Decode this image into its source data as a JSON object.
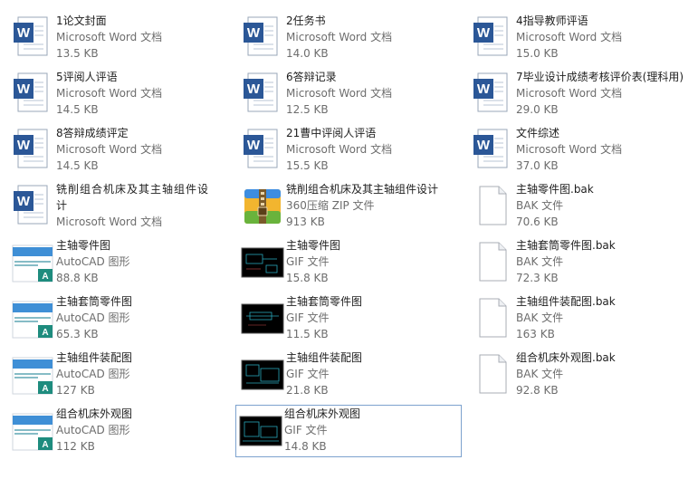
{
  "files": [
    {
      "name": "1论文封面",
      "type": "Microsoft Word 文档",
      "size": "13.5 KB",
      "icon": "word-document-icon"
    },
    {
      "name": "2任务书",
      "type": "Microsoft Word 文档",
      "size": "14.0 KB",
      "icon": "word-document-icon"
    },
    {
      "name": "4指导教师评语",
      "type": "Microsoft Word 文档",
      "size": "15.0 KB",
      "icon": "word-document-icon"
    },
    {
      "name": "5评阅人评语",
      "type": "Microsoft Word 文档",
      "size": "14.5 KB",
      "icon": "word-document-icon"
    },
    {
      "name": "6答辩记录",
      "type": "Microsoft Word 文档",
      "size": "12.5 KB",
      "icon": "word-document-icon"
    },
    {
      "name": "7毕业设计成绩考核评价表(理科用)",
      "type": "Microsoft Word 文档",
      "size": "29.0 KB",
      "icon": "word-document-icon"
    },
    {
      "name": "8答辩成绩评定",
      "type": "Microsoft Word 文档",
      "size": "14.5 KB",
      "icon": "word-document-icon"
    },
    {
      "name": "21曹中评阅人评语",
      "type": "Microsoft Word 文档",
      "size": "15.5 KB",
      "icon": "word-document-icon"
    },
    {
      "name": "文件综述",
      "type": "Microsoft Word 文档",
      "size": "37.0 KB",
      "icon": "word-document-icon"
    },
    {
      "name": "铣削组合机床及其主轴组件设计",
      "type": "Microsoft Word 文档",
      "size": "",
      "icon": "word-document-icon"
    },
    {
      "name": "铣削组合机床及其主轴组件设计",
      "type": "360压缩 ZIP 文件",
      "size": "913 KB",
      "icon": "zip-archive-icon"
    },
    {
      "name": "主轴零件图.bak",
      "type": "BAK 文件",
      "size": "70.6 KB",
      "icon": "blank-file-icon"
    },
    {
      "name": "主轴零件图",
      "type": "AutoCAD 图形",
      "size": "88.8 KB",
      "icon": "autocad-drawing-icon"
    },
    {
      "name": "主轴零件图",
      "type": "GIF 文件",
      "size": "15.8 KB",
      "icon": "gif-thumbnail-icon"
    },
    {
      "name": "主轴套筒零件图.bak",
      "type": "BAK 文件",
      "size": "72.3 KB",
      "icon": "blank-file-icon"
    },
    {
      "name": "主轴套筒零件图",
      "type": "AutoCAD 图形",
      "size": "65.3 KB",
      "icon": "autocad-drawing-icon"
    },
    {
      "name": "主轴套筒零件图",
      "type": "GIF 文件",
      "size": "11.5 KB",
      "icon": "gif-thumbnail-icon"
    },
    {
      "name": "主轴组件装配图.bak",
      "type": "BAK 文件",
      "size": "163 KB",
      "icon": "blank-file-icon"
    },
    {
      "name": "主轴组件装配图",
      "type": "AutoCAD 图形",
      "size": "127 KB",
      "icon": "autocad-drawing-icon"
    },
    {
      "name": "主轴组件装配图",
      "type": "GIF 文件",
      "size": "21.8 KB",
      "icon": "gif-thumbnail-icon"
    },
    {
      "name": "组合机床外观图.bak",
      "type": "BAK 文件",
      "size": "92.8 KB",
      "icon": "blank-file-icon"
    },
    {
      "name": "组合机床外观图",
      "type": "AutoCAD 图形",
      "size": "112 KB",
      "icon": "autocad-drawing-icon"
    },
    {
      "name": "组合机床外观图",
      "type": "GIF 文件",
      "size": "14.8 KB",
      "icon": "gif-thumbnail-icon"
    }
  ],
  "selected_file": "组合机床外观图 (GIF 文件)"
}
